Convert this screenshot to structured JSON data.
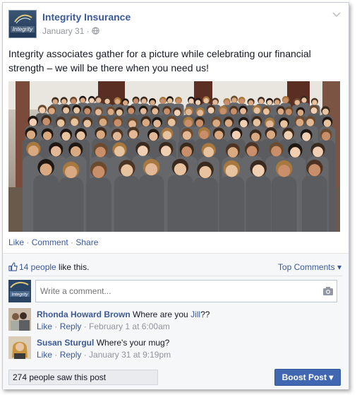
{
  "post": {
    "page_name": "Integrity Insurance",
    "logo_text": "Integrity",
    "date": "January 31",
    "separator": " · ",
    "text": "Integrity associates gather for a picture while celebrating our financial strength – we will be there when you need us!",
    "photo_icon": "group-photo",
    "menu_icon": "chevron-down-icon",
    "audience_icon": "globe-icon"
  },
  "actions": {
    "like": "Like",
    "comment": "Comment",
    "share": "Share",
    "dot": " · "
  },
  "likes": {
    "count_link": "14 people",
    "suffix": " like this.",
    "top_comments": "Top Comments",
    "top_comments_caret": "▾"
  },
  "composer": {
    "placeholder": "Write a comment...",
    "camera_icon": "camera-icon"
  },
  "comments": [
    {
      "author": "Rhonda Howard Brown",
      "text_before": "Where are you ",
      "mention": "Jill",
      "text_after": "??",
      "like": "Like",
      "reply": "Reply",
      "time": "February 1 at 6:00am"
    },
    {
      "author": "Susan Sturgul",
      "text": "Where's your mug?",
      "like": "Like",
      "reply": "Reply",
      "time": "January 31 at 9:19pm"
    }
  ],
  "footer": {
    "reach": "274 people saw this post",
    "boost": "Boost Post",
    "boost_caret": "▾"
  },
  "colors": {
    "link": "#3b5998",
    "meta": "#90949c",
    "boost_bg": "#4267b2",
    "feedback_bg": "#f6f7f9"
  }
}
